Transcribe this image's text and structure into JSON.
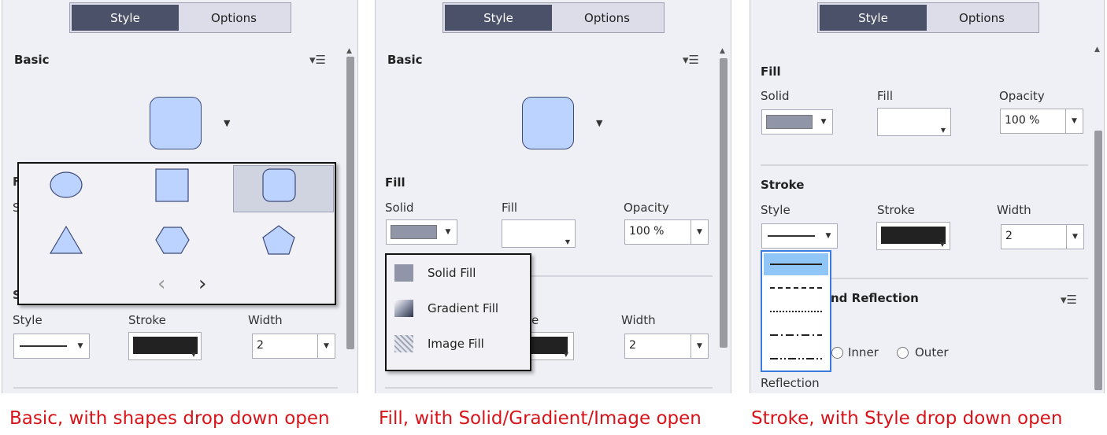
{
  "tabs": {
    "style": "Style",
    "options": "Options"
  },
  "panel1": {
    "basic": "Basic",
    "fill_partial": "F",
    "solid_partial": "S",
    "stroke_partial": "S",
    "style": "Style",
    "stroke": "Stroke",
    "width": "Width",
    "width_value": "2",
    "nav_prev": "‹",
    "nav_next": "›"
  },
  "panel2": {
    "basic": "Basic",
    "fill": "Fill",
    "solid": "Solid",
    "fill_col": "Fill",
    "opacity": "Opacity",
    "opacity_value": "100 %",
    "stroke_partial": "e",
    "width": "Width",
    "width_value": "2",
    "menu": [
      "Solid Fill",
      "Gradient Fill",
      "Image Fill"
    ]
  },
  "panel3": {
    "fill": "Fill",
    "solid": "Solid",
    "fill_col": "Fill",
    "opacity": "Opacity",
    "opacity_value": "100 %",
    "stroke": "Stroke",
    "style": "Style",
    "stroke_col": "Stroke",
    "width": "Width",
    "width_value": "2",
    "shadow_partial": "nd Reflection",
    "inner": "Inner",
    "outer": "Outer",
    "reflection": "Reflection"
  },
  "captions": [
    "Basic, with shapes drop down open",
    "Fill, with Solid/Gradient/Image open",
    "Stroke, with Style drop down open"
  ],
  "colors": {
    "accent_tab": "#4a5168",
    "shape_fill": "#bcd3ff",
    "caption": "#d8141a",
    "selection": "#8fc5f7"
  }
}
